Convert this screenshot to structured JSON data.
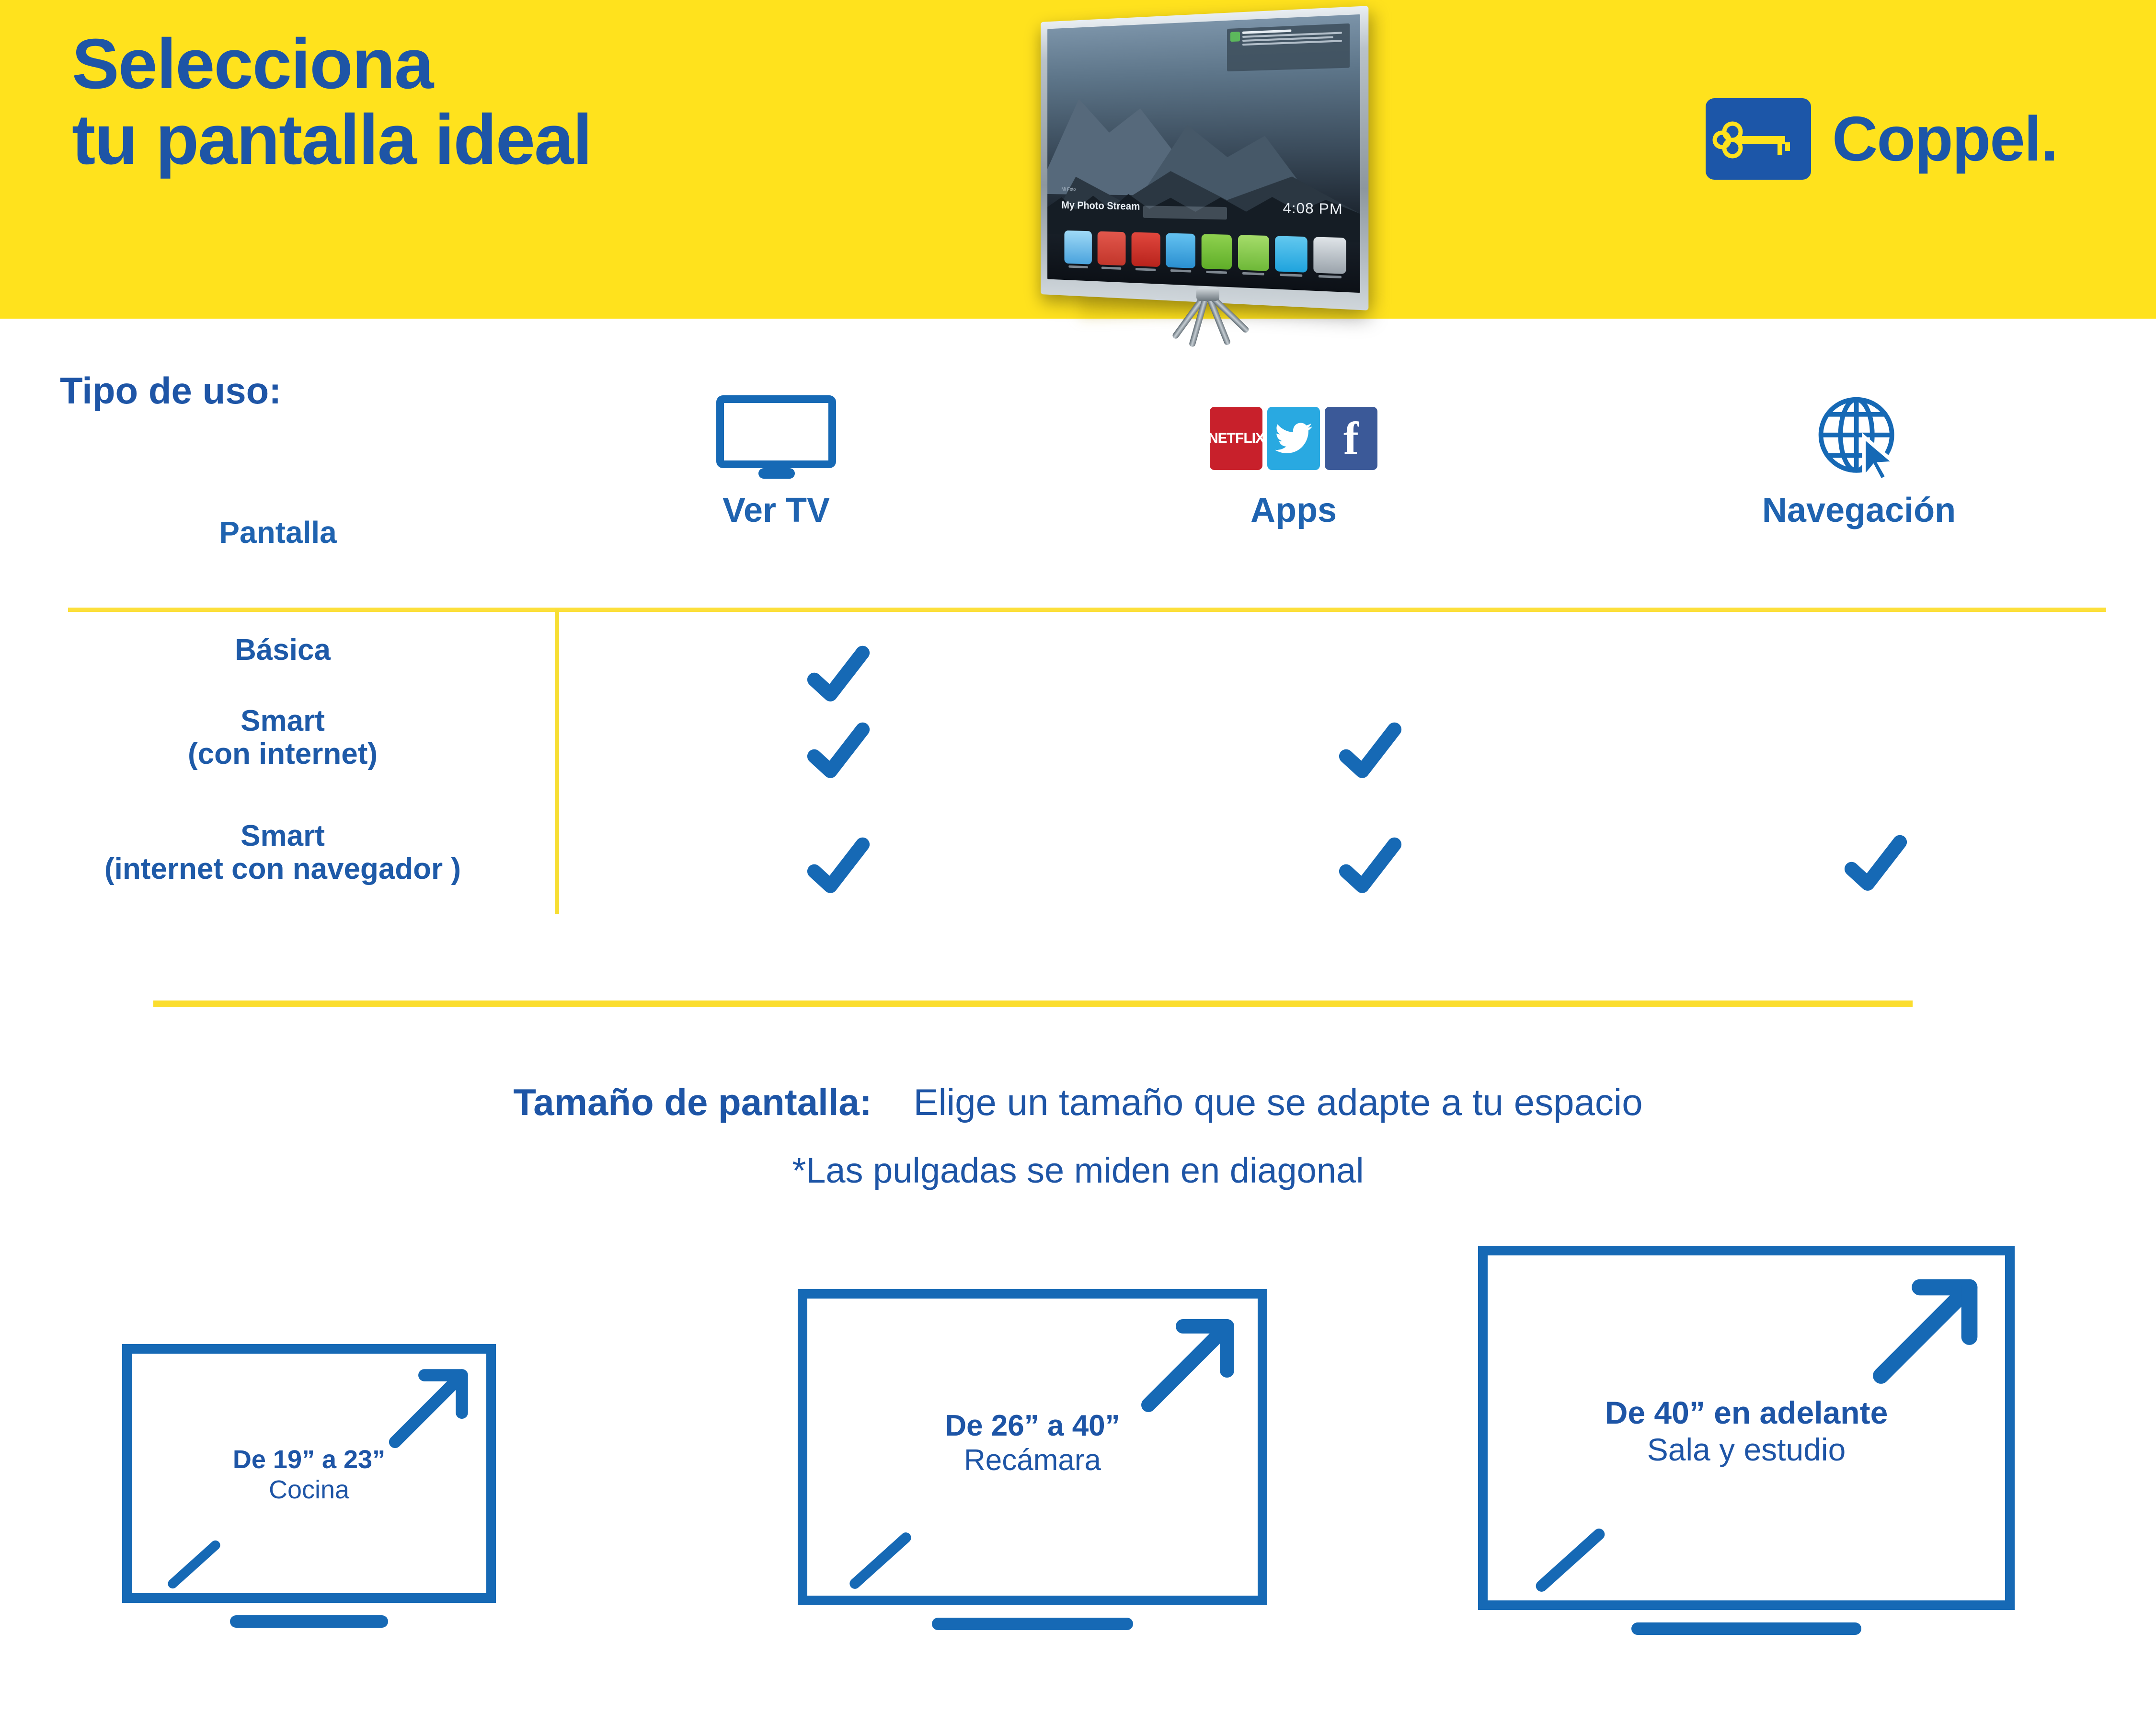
{
  "header": {
    "headline_line1": "Selecciona",
    "headline_line2": "tu pantalla ideal",
    "brand_name": "Coppel.",
    "logo_icon": "key-icon",
    "background_color": "#FFE21D",
    "text_color": "#1E55A6"
  },
  "tv_photo": {
    "overlay_label": "Mi Foto",
    "overlay_title": "My Photo Stream",
    "clock": "4:08 PM",
    "app_dock_count": 8,
    "notification_present": true
  },
  "usage_section": {
    "title": "Tipo de uso:",
    "columns": [
      {
        "label": "Pantalla",
        "icon": "none"
      },
      {
        "label": "Ver TV",
        "icon": "tv-monitor-icon"
      },
      {
        "label": "Apps",
        "icon": "app-logos-icon"
      },
      {
        "label": "Navegación",
        "icon": "globe-cursor-icon"
      }
    ],
    "app_logos": [
      {
        "name": "netflix",
        "text": "NETFLIX",
        "color": "#C8202B"
      },
      {
        "name": "twitter",
        "text": "✦",
        "color": "#29A9E1"
      },
      {
        "name": "facebook",
        "text": "f",
        "color": "#3B5998"
      }
    ],
    "rows": [
      {
        "label_line1": "Básica",
        "label_line2": "",
        "ver_tv": true,
        "apps": false,
        "navegacion": false
      },
      {
        "label_line1": "Smart",
        "label_line2": "(con internet)",
        "ver_tv": true,
        "apps": true,
        "navegacion": false
      },
      {
        "label_line1": "Smart",
        "label_line2": "(internet con navegador )",
        "ver_tv": true,
        "apps": true,
        "navegacion": true
      }
    ],
    "check_color": "#1669B5",
    "rule_color": "#FBDD2E"
  },
  "size_section": {
    "title": "Tamaño de pantalla:",
    "subtitle": "Elige un tamaño que se adapte a tu espacio",
    "note": "*Las pulgadas se miden en diagonal",
    "boxes": [
      {
        "range": "De 19” a 23”",
        "room": "Cocina"
      },
      {
        "range": "De 26” a 40”",
        "room": "Recámara"
      },
      {
        "range": "De 40” en adelante",
        "room": "Sala y estudio"
      }
    ],
    "accent_color": "#1669B5"
  }
}
